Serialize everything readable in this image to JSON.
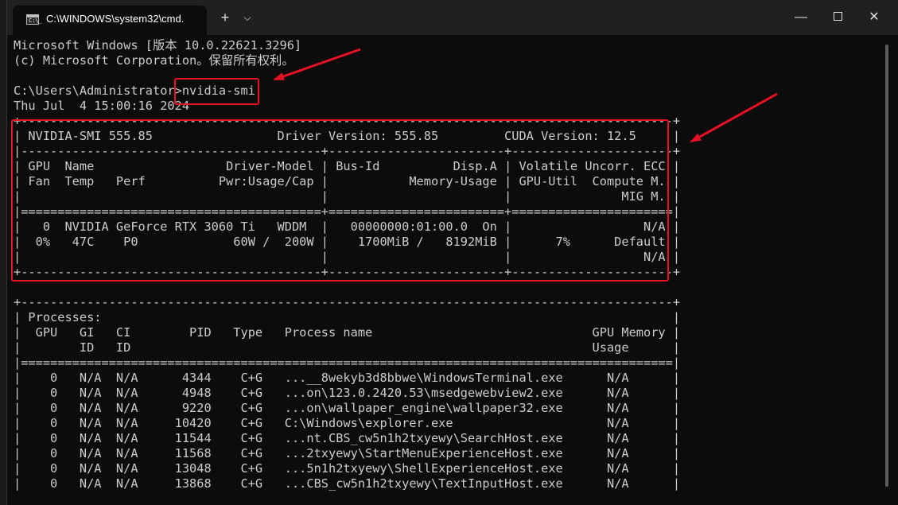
{
  "window": {
    "tab_title": "C:\\WINDOWS\\system32\\cmd.",
    "tab_icon_text": "C:\\_",
    "new_tab": "+",
    "dropdown": "⌵",
    "minimize": "—",
    "close": "✕"
  },
  "terminal": {
    "lines": [
      "Microsoft Windows [版本 10.0.22621.3296]",
      "(c) Microsoft Corporation。保留所有权利。",
      "",
      "C:\\Users\\Administrator>nvidia-smi",
      "Thu Jul  4 15:00:16 2024",
      "+-----------------------------------------------------------------------------------------+",
      "| NVIDIA-SMI 555.85                 Driver Version: 555.85         CUDA Version: 12.5     |",
      "|-----------------------------------------+------------------------+----------------------+",
      "| GPU  Name                  Driver-Model | Bus-Id          Disp.A | Volatile Uncorr. ECC |",
      "| Fan  Temp   Perf          Pwr:Usage/Cap |           Memory-Usage | GPU-Util  Compute M. |",
      "|                                         |                        |               MIG M. |",
      "|=========================================+========================+======================|",
      "|   0  NVIDIA GeForce RTX 3060 Ti   WDDM  |   00000000:01:00.0  On |                  N/A |",
      "|  0%   47C    P0             60W /  200W |    1700MiB /   8192MiB |      7%      Default |",
      "|                                         |                        |                  N/A |",
      "+-----------------------------------------+------------------------+----------------------+",
      "",
      "+-----------------------------------------------------------------------------------------+",
      "| Processes:                                                                              |",
      "|  GPU   GI   CI        PID   Type   Process name                              GPU Memory |",
      "|        ID   ID                                                               Usage      |",
      "|=========================================================================================|",
      "|    0   N/A  N/A      4344    C+G   ...__8wekyb3d8bbwe\\WindowsTerminal.exe      N/A      |",
      "|    0   N/A  N/A      4948    C+G   ...on\\123.0.2420.53\\msedgewebview2.exe      N/A      |",
      "|    0   N/A  N/A      9220    C+G   ...on\\wallpaper_engine\\wallpaper32.exe      N/A      |",
      "|    0   N/A  N/A     10420    C+G   C:\\Windows\\explorer.exe                     N/A      |",
      "|    0   N/A  N/A     11544    C+G   ...nt.CBS_cw5n1h2txyewy\\SearchHost.exe      N/A      |",
      "|    0   N/A  N/A     11568    C+G   ...2txyewy\\StartMenuExperienceHost.exe      N/A      |",
      "|    0   N/A  N/A     13048    C+G   ...5n1h2txyewy\\ShellExperienceHost.exe      N/A      |",
      "|    0   N/A  N/A     13868    C+G   ...CBS_cw5n1h2txyewy\\TextInputHost.exe      N/A      |"
    ]
  },
  "colors": {
    "annotation": "#e81123",
    "background": "#0c0c0c",
    "text": "#cccccc"
  }
}
